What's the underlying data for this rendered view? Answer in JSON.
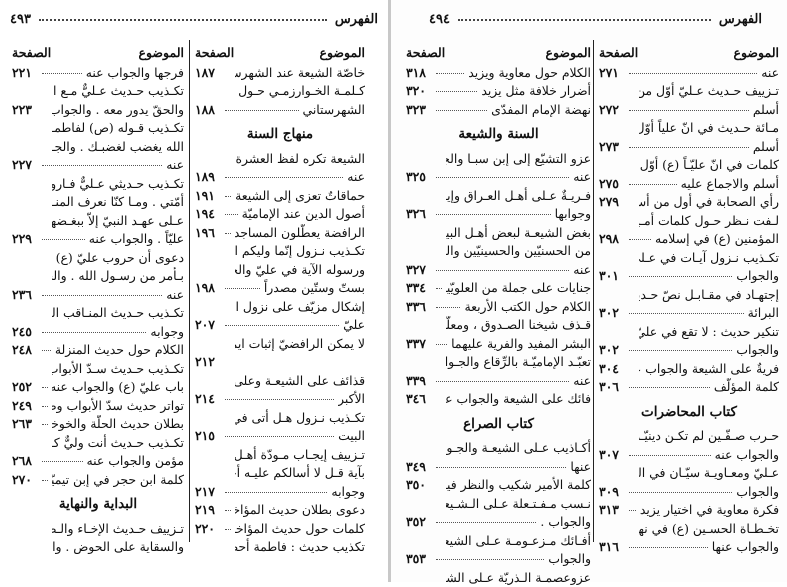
{
  "left_page": {
    "running_head": {
      "title": "الفهرس",
      "page_number": "٤٩٣"
    },
    "columns": [
      {
        "header": {
          "topic": "الموضوع",
          "page": "الصفحة"
        },
        "entries": [
          {
            "text": "خاصّة الشيعة عند الشهرستاني",
            "page": "١٨٧",
            "leader": false
          },
          {
            "text": "كـلمـة الخـوارزمـي حـول",
            "page": "",
            "leader": false
          },
          {
            "text": "الشهرستاني",
            "page": "١٨٨",
            "leader": true
          },
          {
            "section": "منهاج السنة"
          },
          {
            "text": "الشيعة تكره لفظ العشرة والجواب",
            "page": "",
            "leader": false
          },
          {
            "text": "عنه",
            "page": "١٨٩",
            "leader": true
          },
          {
            "text": "حماقاتٌ تعزى إلى الشيعة",
            "page": "١٩١",
            "leader": true
          },
          {
            "text": "أصول الدين عند الإماميّة",
            "page": "١٩٤",
            "leader": true
          },
          {
            "text": "الرافضة يعطّلون المساجد",
            "page": "١٩٦",
            "leader": true
          },
          {
            "text": "تكـذيب نـزول إنّما وليكم الله",
            "page": "",
            "leader": false
          },
          {
            "text": "ورسوله الآية في عليّ والجواب عنه",
            "page": "",
            "leader": false
          },
          {
            "text": "بستّ وستّين مصدراً",
            "page": "١٩٨",
            "leader": true
          },
          {
            "text": "إشكال مزيّف على نزول الآيـة في",
            "page": "",
            "leader": false
          },
          {
            "text": "عليّ",
            "page": "٢٠٧",
            "leader": true
          },
          {
            "text": "لا يمكن الرافضيّ إثبات ايمان عليّ",
            "page": "",
            "leader": false
          },
          {
            "text": "",
            "page": "٢١٢",
            "leader": false
          },
          {
            "text": "قذائف على الشيعـة وعلى شيخهـا",
            "page": "",
            "leader": false
          },
          {
            "text": "الأكبر",
            "page": "٢١٤",
            "leader": true
          },
          {
            "text": "تكـذيب نـزول هـل أتى في أهـل",
            "page": "",
            "leader": false
          },
          {
            "text": "البيت",
            "page": "٢١٥",
            "leader": true
          },
          {
            "text": "تـزييف إيجـاب مـودّة أهـل البيت",
            "page": "",
            "leader": false
          },
          {
            "text": "بآية قـل لا أسالكم عليـه أجراً .",
            "page": "",
            "leader": false
          },
          {
            "text": "وجوابه",
            "page": "٢١٧",
            "leader": true
          },
          {
            "text": "دعوى بطلان حديث المؤاخاة",
            "page": "٢١٩",
            "leader": true
          },
          {
            "text": "كلمات حول حديث المؤاخاة",
            "page": "٢٢٠",
            "leader": true
          },
          {
            "text": "تكذيب حديث : فاطمة أحصنت",
            "page": "",
            "leader": false
          }
        ]
      },
      {
        "header": {
          "topic": "الموضوع",
          "page": "الصفحة"
        },
        "entries": [
          {
            "text": "فرجها والجواب عنه",
            "page": "٢٢١",
            "leader": true
          },
          {
            "text": "تكـذيب حـديث عـليٌّ مـع الحقّ",
            "page": "",
            "leader": false
          },
          {
            "text": "والحقّ يدور معه . والجواب عنه",
            "page": "٢٢٣",
            "leader": false
          },
          {
            "text": "تكـذيب قـوله (ص) لفاطمـة : ان",
            "page": "",
            "leader": false
          },
          {
            "text": "الله يغضب لغضبـك . والجـواب",
            "page": "",
            "leader": false
          },
          {
            "text": "عنه",
            "page": "٢٢٧",
            "leader": true
          },
          {
            "text": "تكـذيب حـديثي عـليٌّ فـاروق",
            "page": "",
            "leader": false
          },
          {
            "text": "أمّتي . ومـا كنّا نعرف المنـافقين",
            "page": "",
            "leader": false
          },
          {
            "text": "عـلى عهـد النبيّ إلاّ ببغـضهـم",
            "page": "",
            "leader": false
          },
          {
            "text": "عليّاً . والجواب عنه",
            "page": "٢٢٩",
            "leader": true
          },
          {
            "text": "دعوى أن حروب عليّ (ع) لم يكن",
            "page": "",
            "leader": false
          },
          {
            "text": "بـأمر من رسـول الله . والجـواب",
            "page": "",
            "leader": false
          },
          {
            "text": "عنه",
            "page": "٢٣٦",
            "leader": true
          },
          {
            "text": "تكـذيب حـديث المنـاقب العشر",
            "page": "",
            "leader": false
          },
          {
            "text": "وجوابه",
            "page": "٢٤٥",
            "leader": true
          },
          {
            "text": "الكلام حول حديث المنزلة",
            "page": "٢٤٨",
            "leader": true
          },
          {
            "text": "تكـذيب حـديث سـدّ الأبواب إلاّ",
            "page": "",
            "leader": false
          },
          {
            "text": "باب عليّ (ع) والجواب عنه",
            "page": "٢٥٢",
            "leader": true
          },
          {
            "text": "تواتر حديث سدّ الأبواب وطرقه",
            "page": "٢٤٩",
            "leader": true
          },
          {
            "text": "بطلان حديث الحلّة والخوخة",
            "page": "٢٦٣",
            "leader": true
          },
          {
            "text": "تكـذيب حـديث أنت وليٌّ كـلّ",
            "page": "",
            "leader": false
          },
          {
            "text": "مؤمن والجواب عنه",
            "page": "٢٦٨",
            "leader": true
          },
          {
            "text": "كلمة ابن حجر في إبن تيميّة",
            "page": "٢٧٠",
            "leader": true
          },
          {
            "section": "البداية والنهاية"
          },
          {
            "text": "تـزييف حـديث الإخـاء والـطير",
            "page": "",
            "leader": false
          },
          {
            "text": "والسقاية على الحوض . والجـواب",
            "page": "",
            "leader": false
          }
        ]
      }
    ]
  },
  "right_page": {
    "running_head": {
      "title": "الفهرس",
      "page_number": "٤٩٤"
    },
    "columns": [
      {
        "header": {
          "topic": "الموضوع",
          "page": "الصفحة"
        },
        "entries": [
          {
            "text": "عنه",
            "page": "٢٧١",
            "leader": true
          },
          {
            "text": "تـزييف حـديث عـليّ أوّل من",
            "page": "",
            "leader": false
          },
          {
            "text": "أسلم",
            "page": "٢٧٢",
            "leader": true
          },
          {
            "text": "مـائة حـديث في انّ علياً أوّل من",
            "page": "",
            "leader": false
          },
          {
            "text": "أسلم",
            "page": "٢٧٣",
            "leader": true
          },
          {
            "text": "كلمات في انّ عليّـاً (ع) أوّل مـن",
            "page": "",
            "leader": false
          },
          {
            "text": "أسلم والاجماع عليه",
            "page": "٢٧٥",
            "leader": true
          },
          {
            "text": "رأي الصحابة في أول من أسلم",
            "page": "٢٧٩",
            "leader": false
          },
          {
            "text": "لـفت نـظر حـول كلمات أمـير",
            "page": "",
            "leader": false
          },
          {
            "text": "المؤمنين (ع) في إسلامه",
            "page": "٢٩٨",
            "leader": true
          },
          {
            "text": "تكـذيب نـزول آيـات في عـلي",
            "page": "",
            "leader": false
          },
          {
            "text": "والجواب",
            "page": "٣٠١",
            "leader": true
          },
          {
            "text": "إجتهـاد في مقـابـل نصّ حـديث",
            "page": "",
            "leader": false
          },
          {
            "text": "البرائة",
            "page": "٣٠٢",
            "leader": true
          },
          {
            "text": "تنكير حديث : لا تقع في عليّ .",
            "page": "",
            "leader": false
          },
          {
            "text": "والجواب",
            "page": "٣٠٢",
            "leader": true
          },
          {
            "text": "فريةٌ على الشيعة والجواب عنها",
            "page": "٣٠٤",
            "leader": false
          },
          {
            "text": "كلمة المؤلّف",
            "page": "٣٠٦",
            "leader": true
          },
          {
            "section": "كتاب المحاضرات"
          },
          {
            "text": "حـرب صـفّـين لم تكـن دينيّـة",
            "page": "",
            "leader": false
          },
          {
            "text": "والجواب عنه",
            "page": "٣٠٧",
            "leader": true
          },
          {
            "text": "عـليّ ومعـاويـة سيّـان في النسب",
            "page": "",
            "leader": false
          },
          {
            "text": "والجواب",
            "page": "٣٠٩",
            "leader": true
          },
          {
            "text": "فكرة معاوية في اختيار يزيد",
            "page": "٣١٣",
            "leader": true
          },
          {
            "text": "تخـطـاة الحسـين (ع) في نهضتـه",
            "page": "",
            "leader": false
          },
          {
            "text": "والجواب عنها",
            "page": "٣١٦",
            "leader": true
          }
        ]
      },
      {
        "header": {
          "topic": "الموضوع",
          "page": "الصفحة"
        },
        "entries": [
          {
            "text": "الكلام حول معاوية ويزيد",
            "page": "٣١٨",
            "leader": true
          },
          {
            "text": "أضرار خلافة مثل يزيد",
            "page": "٣٢٠",
            "leader": true
          },
          {
            "text": "نهضة الإمام المفدّى",
            "page": "٣٢٣",
            "leader": true
          },
          {
            "section": "السنة والشيعة"
          },
          {
            "text": "عزو التشيّع إلى إبن سبـا والجواب",
            "page": "",
            "leader": false
          },
          {
            "text": "عنه",
            "page": "٣٢٥",
            "leader": true
          },
          {
            "text": "فـريـةٌ عـلى أهـل العـراق وإيـران",
            "page": "",
            "leader": false
          },
          {
            "text": "وجوابها",
            "page": "٣٢٦",
            "leader": true
          },
          {
            "text": "بغض الشيعـة لبعض أهـل البيت",
            "page": "",
            "leader": false
          },
          {
            "text": "من الحسنيّين والحسينيّين والجواب",
            "page": "",
            "leader": false
          },
          {
            "text": "عنه",
            "page": "٣٢٧",
            "leader": true
          },
          {
            "text": "جنايات على جملة من العلويّين",
            "page": "٣٣٤",
            "leader": true
          },
          {
            "text": "الكلام حول الكتب الأربعة",
            "page": "٣٣٦",
            "leader": true
          },
          {
            "text": "قـذف شيخنا الصـدوق ، ومعلّم",
            "page": "",
            "leader": false
          },
          {
            "text": "البشر المفيد والفرية عليهما",
            "page": "٣٣٧",
            "leader": true
          },
          {
            "text": "تعبّـد الإماميّـة بالرِّقاع والجـواب",
            "page": "",
            "leader": false
          },
          {
            "text": "عنه",
            "page": "٣٣٩",
            "leader": true
          },
          {
            "text": "فائك على الشيعة والجواب عنها",
            "page": "٣٤٦",
            "leader": false
          },
          {
            "section": "كتاب الصراع"
          },
          {
            "text": "أكـاذيب عـلى الشيعـة والجـواب",
            "page": "",
            "leader": false
          },
          {
            "text": "عنها",
            "page": "٣٤٩",
            "leader": true
          },
          {
            "text": "كلمة الأمير شكيب والنظر فيها",
            "page": "٣٥٠",
            "leader": false
          },
          {
            "text": "نـسب مـفـتـعلة عـلى الـشـيعـة",
            "page": "",
            "leader": false
          },
          {
            "text": "والجواب .",
            "page": "٣٥٢",
            "leader": true
          },
          {
            "text": "أفـائك مـزعـومـة عـلى الشيعـة",
            "page": "",
            "leader": false
          },
          {
            "text": "والجواب",
            "page": "٣٥٣",
            "leader": true
          },
          {
            "text": "عزوعصمـة الـذريّة عـلى الشيعة",
            "page": "",
            "leader": false
          }
        ]
      }
    ]
  }
}
